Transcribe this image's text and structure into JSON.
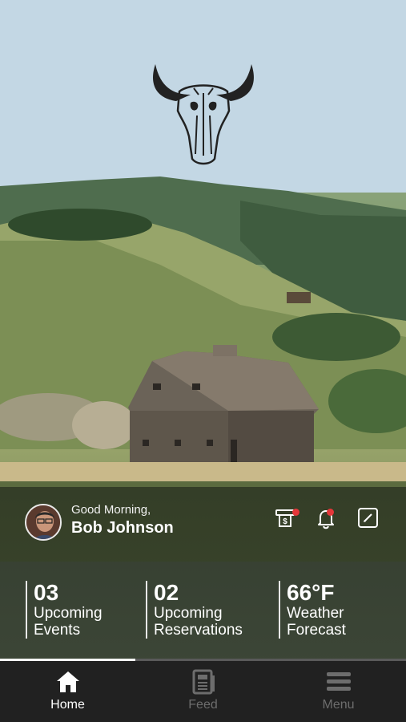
{
  "header": {
    "greeting": "Good Morning,",
    "user_name": "Bob Johnson",
    "icons": [
      "bill-icon",
      "bell-icon",
      "edit-icon"
    ],
    "bill_has_notification": true,
    "bell_has_notification": true
  },
  "stats": [
    {
      "value": "03",
      "label_line1": "Upcoming",
      "label_line2": "Events"
    },
    {
      "value": "02",
      "label_line1": "Upcoming",
      "label_line2": "Reservations"
    },
    {
      "value": "66°F",
      "label_line1": "Weather",
      "label_line2": "Forecast"
    }
  ],
  "tabs": [
    {
      "label": "Home",
      "icon": "home-icon",
      "active": true
    },
    {
      "label": "Feed",
      "icon": "feed-icon",
      "active": false
    },
    {
      "label": "Menu",
      "icon": "menu-icon",
      "active": false
    }
  ],
  "colors": {
    "notification": "#e5373a",
    "tabbar_bg": "#212121",
    "tab_active": "#ffffff",
    "tab_inactive": "#6d6d6d"
  }
}
